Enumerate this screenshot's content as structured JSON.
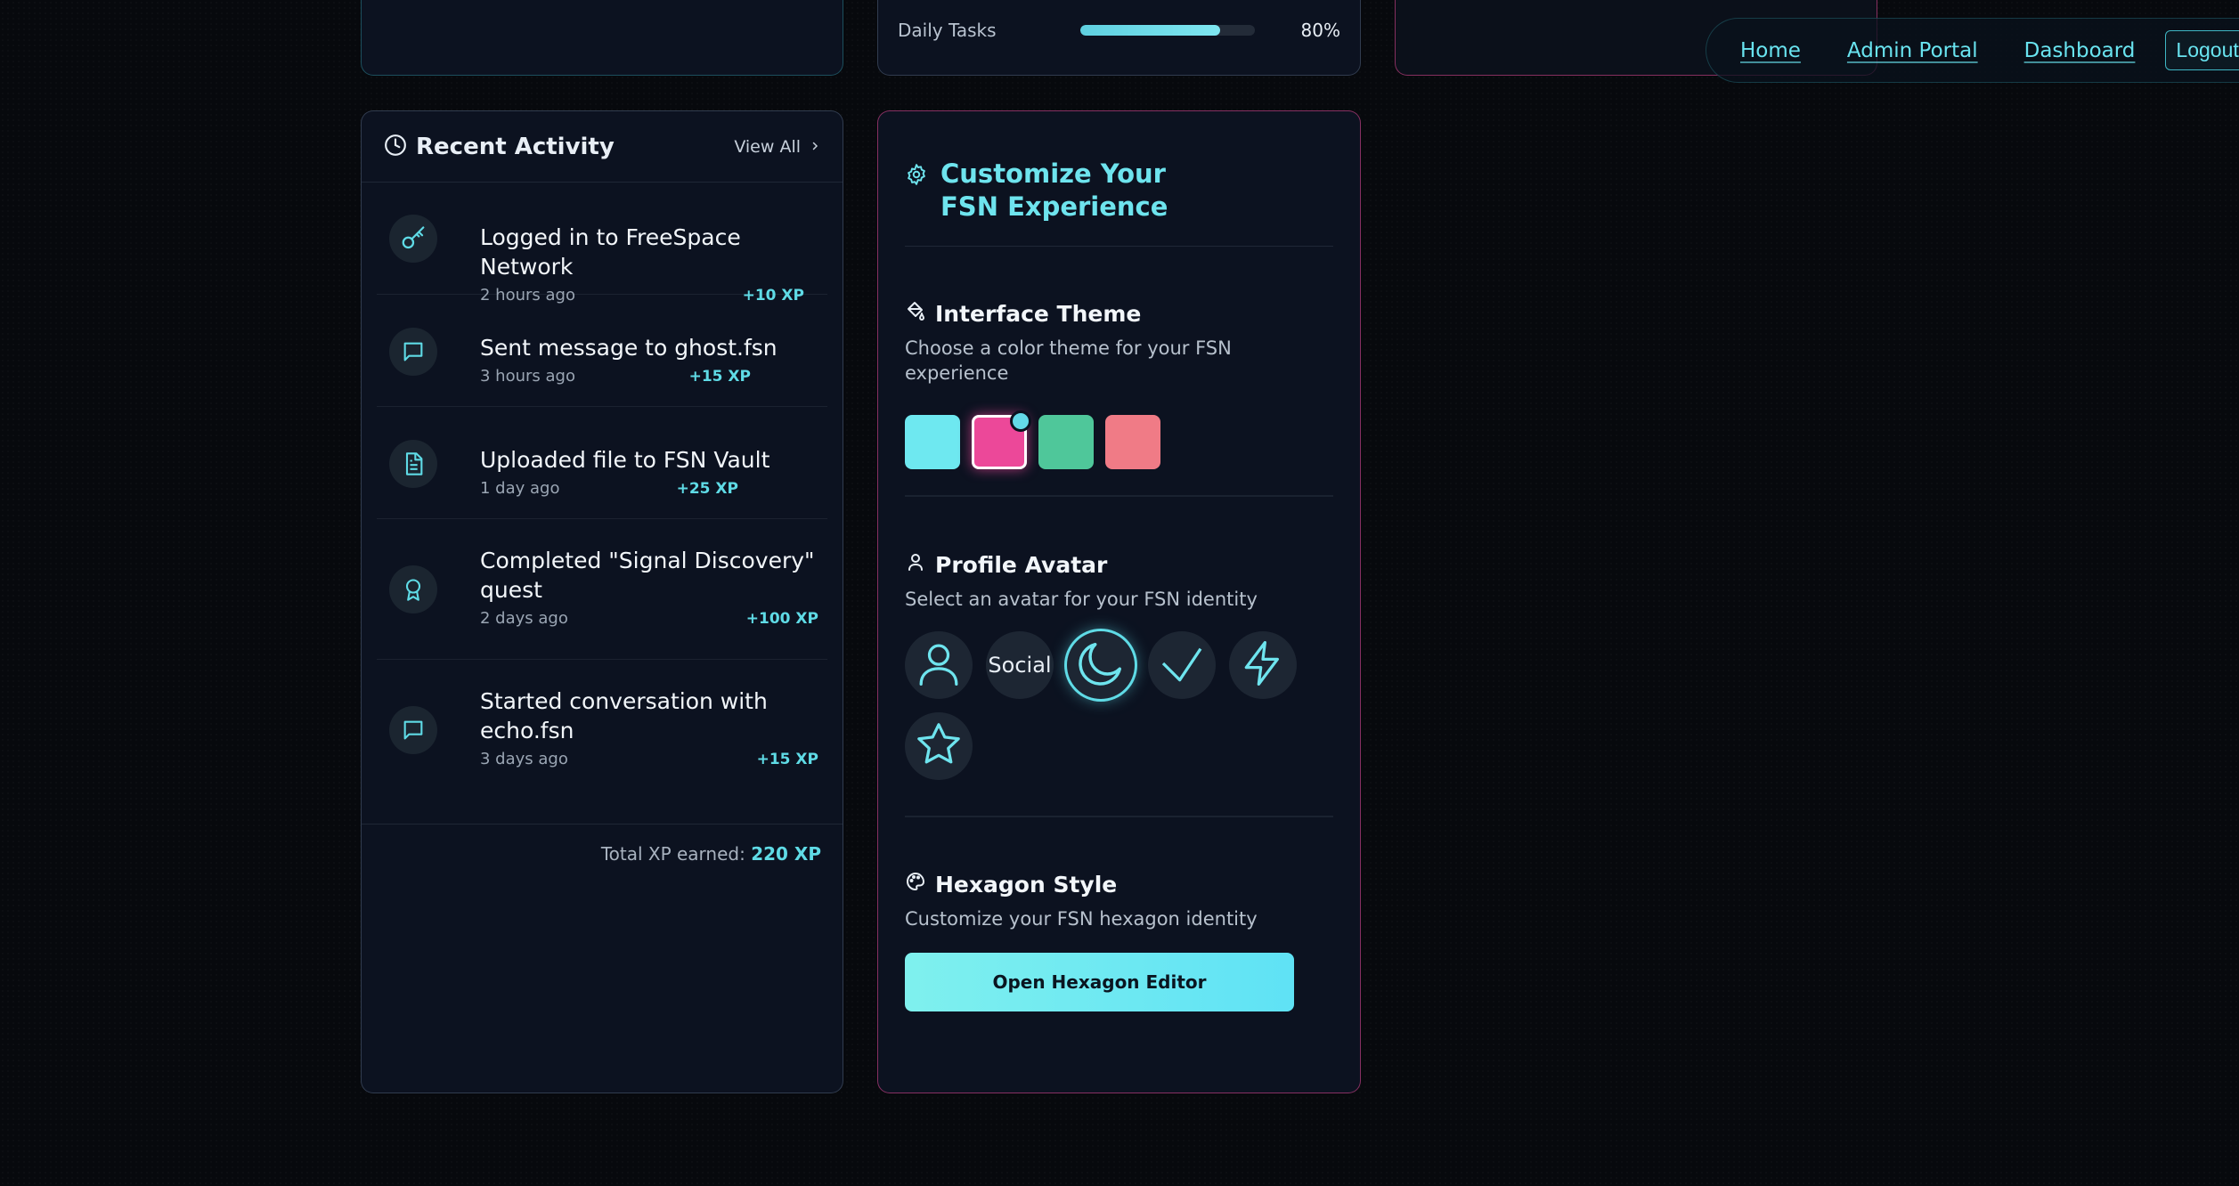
{
  "nav": {
    "home": "Home",
    "admin": "Admin Portal",
    "dashboard": "Dashboard",
    "logout": "Logout"
  },
  "daily": {
    "label": "Daily Tasks",
    "percent_text": "80%",
    "progress": 0.8
  },
  "activity": {
    "title": "Recent Activity",
    "view_all": "View All",
    "items": [
      {
        "text": "Logged in to FreeSpace Network",
        "time": "2 hours ago",
        "xp": "+10 XP",
        "icon": "key-icon"
      },
      {
        "text": "Sent message to ghost.fsn",
        "time": "3 hours ago",
        "xp": "+15 XP",
        "icon": "message-icon"
      },
      {
        "text": "Uploaded file to FSN Vault",
        "time": "1 day ago",
        "xp": "+25 XP",
        "icon": "file-icon"
      },
      {
        "text": "Completed \"Signal Discovery\" quest",
        "time": "2 days ago",
        "xp": "+100 XP",
        "icon": "award-icon"
      },
      {
        "text": "Started conversation with echo.fsn",
        "time": "3 days ago",
        "xp": "+15 XP",
        "icon": "message-icon"
      }
    ],
    "total_label": "Total XP earned:",
    "total_value": "220 XP"
  },
  "customize": {
    "title": "Customize Your FSN Experience",
    "theme": {
      "title": "Interface Theme",
      "desc": "Choose a color theme for your FSN experience",
      "colors": [
        "#6ee8f0",
        "#ec4899",
        "#4fc79a",
        "#f07b86"
      ],
      "selected_index": 1
    },
    "avatar": {
      "title": "Profile Avatar",
      "desc": "Select an avatar for your FSN identity",
      "social_alt": "Social",
      "options": [
        "user-icon",
        "social-image",
        "moon-icon",
        "diamond-icon",
        "lightning-icon",
        "star-icon"
      ],
      "selected_index": 2
    },
    "hexagon": {
      "title": "Hexagon Style",
      "desc": "Customize your FSN hexagon identity",
      "button": "Open Hexagon Editor"
    }
  },
  "colors": {
    "accent": "#5fdbe6",
    "pink": "#ec4899"
  }
}
